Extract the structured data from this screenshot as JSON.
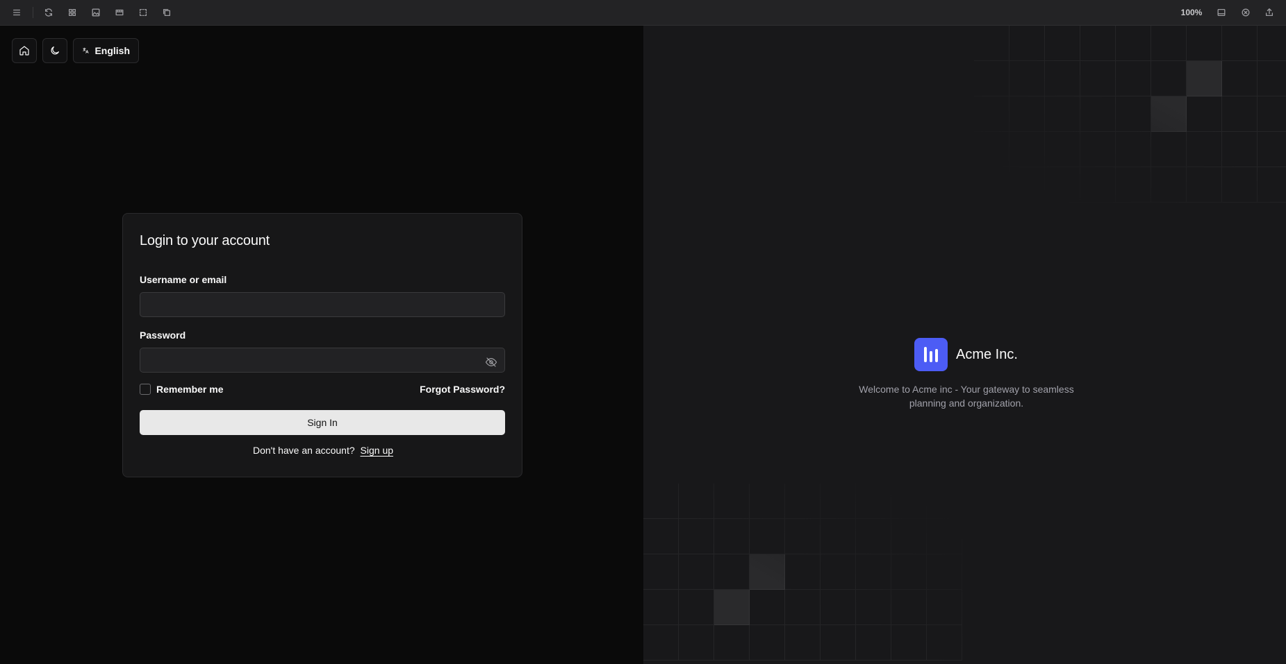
{
  "toolbar": {
    "zoom": "100%",
    "icons": [
      "menu-icon",
      "refresh-icon",
      "grid-icon",
      "image-icon",
      "ruler-icon",
      "select-icon",
      "layers-icon",
      "panel-icon",
      "close-circle-icon",
      "share-icon"
    ]
  },
  "topnav": {
    "home_icon": "home-icon",
    "theme_icon": "moon-icon",
    "language_label": "English",
    "language_icon": "translate-icon"
  },
  "login": {
    "title": "Login to your account",
    "username_label": "Username or email",
    "username_value": "",
    "password_label": "Password",
    "password_value": "",
    "remember_label": "Remember me",
    "remember_checked": false,
    "forgot_label": "Forgot Password?",
    "signin_label": "Sign In",
    "no_account_text": "Don't have an account?",
    "signup_label": "Sign up"
  },
  "brand": {
    "name": "Acme Inc.",
    "tagline": "Welcome to Acme inc - Your gateway to seamless planning and organization.",
    "logo_color": "#4c5cf5"
  }
}
